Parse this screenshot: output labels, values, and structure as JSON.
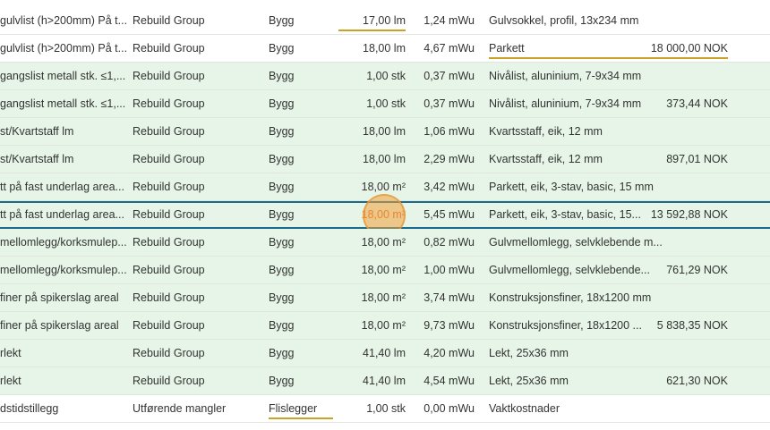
{
  "rows": [
    {
      "desc": "gulvlist (h>200mm) På t...",
      "supplier": "Rebuild Group",
      "trade": "Bygg",
      "qty": "17,00 lm",
      "mwu": "1,24 mWu",
      "product": "Gulvsokkel, profil, 13x234 mm",
      "price": "",
      "green": false,
      "qty_underline": true
    },
    {
      "desc": "gulvlist (h>200mm) På t...",
      "supplier": "Rebuild Group",
      "trade": "Bygg",
      "qty": "18,00 lm",
      "mwu": "4,67 mWu",
      "product": "Parkett",
      "price": "18 000,00 NOK",
      "green": false,
      "product_underline": true
    },
    {
      "desc": "gangslist metall stk. ≤1,...",
      "supplier": "Rebuild Group",
      "trade": "Bygg",
      "qty": "1,00 stk",
      "mwu": "0,37 mWu",
      "product": "Nivålist, aluninium, 7-9x34 mm",
      "price": "",
      "green": true
    },
    {
      "desc": "gangslist metall stk. ≤1,...",
      "supplier": "Rebuild Group",
      "trade": "Bygg",
      "qty": "1,00 stk",
      "mwu": "0,37 mWu",
      "product": "Nivålist, aluninium, 7-9x34 mm",
      "price": "373,44 NOK",
      "green": true
    },
    {
      "desc": "st/Kvartstaff lm",
      "supplier": "Rebuild Group",
      "trade": "Bygg",
      "qty": "18,00 lm",
      "mwu": "1,06 mWu",
      "product": "Kvartsstaff, eik, 12 mm",
      "price": "",
      "green": true
    },
    {
      "desc": "st/Kvartstaff lm",
      "supplier": "Rebuild Group",
      "trade": "Bygg",
      "qty": "18,00 lm",
      "mwu": "2,29 mWu",
      "product": "Kvartsstaff, eik, 12 mm",
      "price": "897,01 NOK",
      "green": true
    },
    {
      "desc": "tt på fast underlag area...",
      "supplier": "Rebuild Group",
      "trade": "Bygg",
      "qty": "18,00 m²",
      "mwu": "3,42 mWu",
      "product": "Parkett, eik, 3-stav, basic, 15 mm",
      "price": "",
      "green": true
    },
    {
      "desc": "tt på fast underlag area...",
      "supplier": "Rebuild Group",
      "trade": "Bygg",
      "qty": "18,00 m²",
      "mwu": "5,45 mWu",
      "product": "Parkett, eik, 3-stav, basic, 15...",
      "price": "13 592,88 NOK",
      "green": true,
      "selected": true
    },
    {
      "desc": "mellomlegg/korksmulep...",
      "supplier": "Rebuild Group",
      "trade": "Bygg",
      "qty": "18,00 m²",
      "mwu": "0,82 mWu",
      "product": "Gulvmellomlegg, selvklebende m...",
      "price": "",
      "green": true
    },
    {
      "desc": "mellomlegg/korksmulep...",
      "supplier": "Rebuild Group",
      "trade": "Bygg",
      "qty": "18,00 m²",
      "mwu": "1,00 mWu",
      "product": "Gulvmellomlegg, selvklebende...",
      "price": "761,29 NOK",
      "green": true
    },
    {
      "desc": "finer på spikerslag areal",
      "supplier": "Rebuild Group",
      "trade": "Bygg",
      "qty": "18,00 m²",
      "mwu": "3,74 mWu",
      "product": "Konstruksjonsfiner, 18x1200 mm",
      "price": "",
      "green": true
    },
    {
      "desc": "finer på spikerslag areal",
      "supplier": "Rebuild Group",
      "trade": "Bygg",
      "qty": "18,00 m²",
      "mwu": "9,73 mWu",
      "product": "Konstruksjonsfiner, 18x1200 ...",
      "price": "5 838,35 NOK",
      "green": true
    },
    {
      "desc": "rlekt",
      "supplier": "Rebuild Group",
      "trade": "Bygg",
      "qty": "41,40 lm",
      "mwu": "4,20 mWu",
      "product": "Lekt, 25x36 mm",
      "price": "",
      "green": true
    },
    {
      "desc": "rlekt",
      "supplier": "Rebuild Group",
      "trade": "Bygg",
      "qty": "41,40 lm",
      "mwu": "4,54 mWu",
      "product": "Lekt, 25x36 mm",
      "price": "621,30 NOK",
      "green": true
    },
    {
      "desc": "dstidstillegg",
      "supplier": "Utførende mangler",
      "trade": "Flislegger",
      "qty": "1,00 stk",
      "mwu": "0,00 mWu",
      "product": "Vaktkostnader",
      "price": "",
      "green": false,
      "trade_underline": true
    }
  ]
}
